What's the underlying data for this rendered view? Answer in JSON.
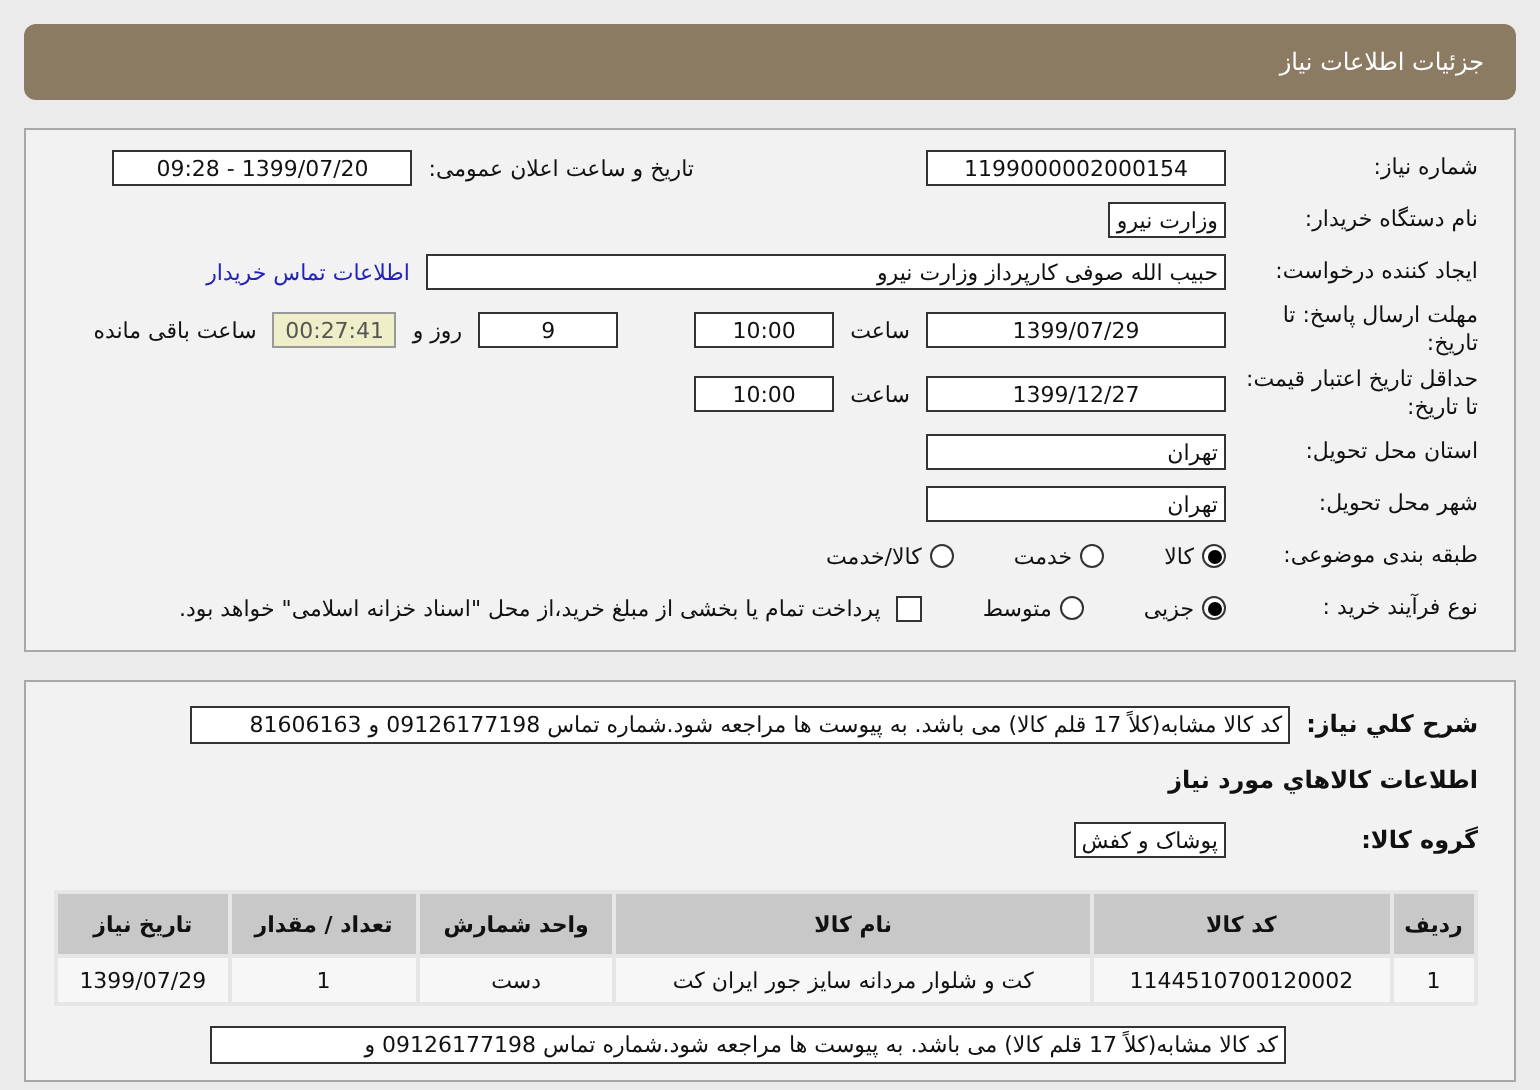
{
  "title": "جزئیات اطلاعات نیاز",
  "need_number": {
    "label": "شماره نیاز:",
    "value": "1199000002000154"
  },
  "announce": {
    "label": "تاریخ و ساعت اعلان عمومی:",
    "value": "1399/07/20 - 09:28"
  },
  "buyer": {
    "label": "نام دستگاه خریدار:",
    "value": "وزارت نیرو"
  },
  "creator": {
    "label": "ایجاد کننده درخواست:",
    "value": "حبیب الله صوفی کارپرداز وزارت نیرو",
    "link": "اطلاعات تماس خریدار"
  },
  "reply_deadline": {
    "label": "مهلت ارسال پاسخ: تا تاریخ:",
    "date": "1399/07/29",
    "time_label": "ساعت",
    "time": "10:00",
    "days": "9",
    "days_label": "روز و",
    "remaining": "00:27:41",
    "remaining_label": "ساعت باقی مانده"
  },
  "price_validity": {
    "label": "حداقل تاریخ اعتبار قیمت: تا تاریخ:",
    "date": "1399/12/27",
    "time_label": "ساعت",
    "time": "10:00"
  },
  "province": {
    "label": "استان محل تحویل:",
    "value": "تهران"
  },
  "city": {
    "label": "شهر محل تحویل:",
    "value": "تهران"
  },
  "category": {
    "label": "طبقه بندی موضوعی:",
    "options": [
      {
        "label": "کالا",
        "selected": true
      },
      {
        "label": "خدمت",
        "selected": false
      },
      {
        "label": "کالا/خدمت",
        "selected": false
      }
    ]
  },
  "process": {
    "label": "نوع فرآیند خرید :",
    "options": [
      {
        "label": "جزیی",
        "selected": true
      },
      {
        "label": "متوسط",
        "selected": false
      }
    ],
    "treasury": {
      "label": "پرداخت تمام یا بخشی از مبلغ خرید،از محل \"اسناد خزانه اسلامی\" خواهد بود.",
      "checked": false
    }
  },
  "description": {
    "label": "شرح كلي نياز:",
    "value": "کد کالا مشابه(کلاً 17 قلم کالا) می باشد. به پیوست ها مراجعه شود.شماره تماس 09126177198  و 81606163"
  },
  "goods_heading": "اطلاعات كالاهاي مورد نياز",
  "goods_group": {
    "label": "گروه کالا:",
    "value": "پوشاک و کفش"
  },
  "table": {
    "columns": [
      "ردیف",
      "کد کالا",
      "نام کالا",
      "واحد شمارش",
      "تعداد / مقدار",
      "تاریخ نیاز"
    ],
    "rows": [
      [
        "1",
        "1144510700120002",
        "کت و شلوار مردانه سایز جور ایران کت",
        "دست",
        "1",
        "1399/07/29"
      ]
    ]
  },
  "note": {
    "value": "کد کالا مشابه(کلاً 17 قلم کالا) می باشد. به پیوست ها مراجعه شود.شماره تماس 09126177198  و"
  }
}
